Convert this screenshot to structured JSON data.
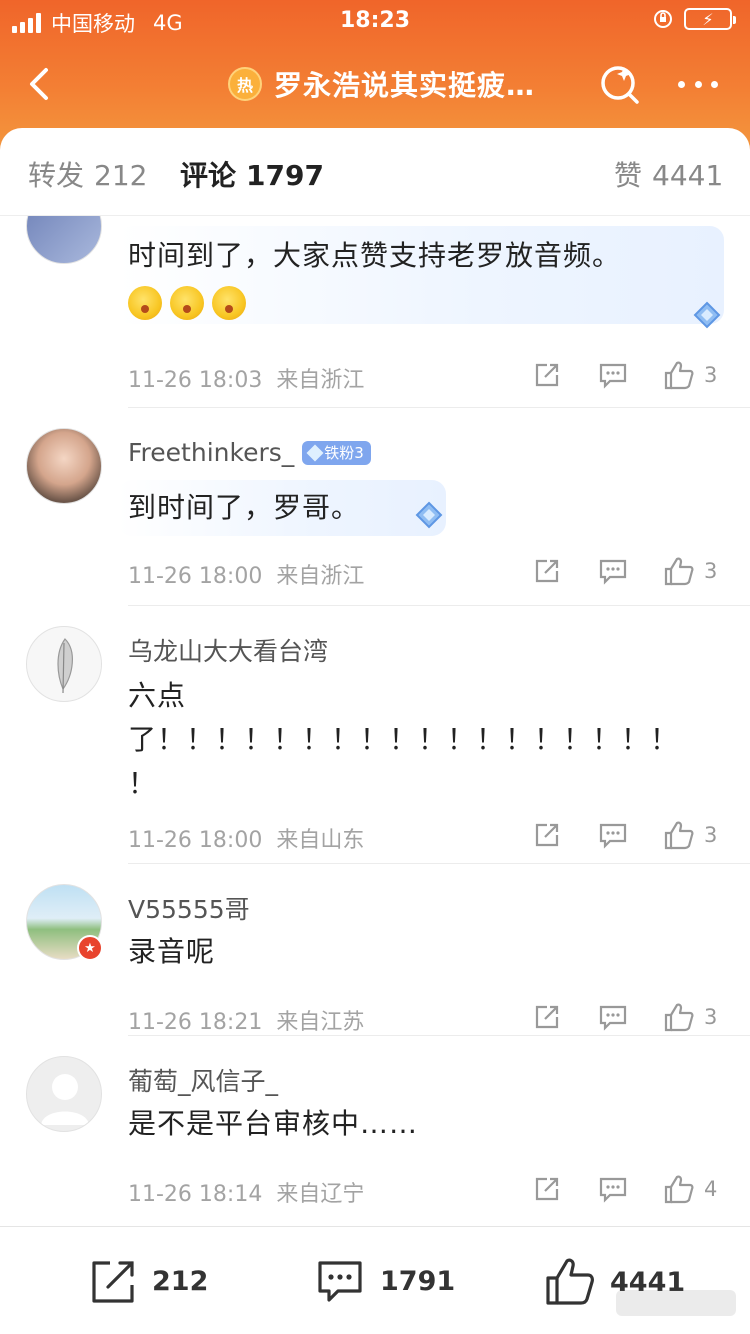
{
  "status_bar": {
    "carrier": "中国移动",
    "network": "4G",
    "time": "18:23",
    "battery_icon": "battery-charging-icon"
  },
  "header": {
    "hot_badge": "热",
    "title": "罗永浩说其实挺疲…",
    "colors": {
      "gradient_top": "#f0652a",
      "gradient_bottom": "#f39a3f"
    }
  },
  "tabs": [
    {
      "label": "转发",
      "count": "212"
    },
    {
      "label": "评论",
      "count": "1797"
    },
    {
      "label": "赞",
      "count": "4441"
    }
  ],
  "comments": [
    {
      "username": "",
      "text": "时间到了，大家点赞支持老罗放音频。",
      "emoji_count": 3,
      "time": "11-26 18:03",
      "region": "来自浙江",
      "likes": "3"
    },
    {
      "username": "Freethinkers_",
      "badge": "铁粉3",
      "text": "到时间了，罗哥。",
      "time": "11-26 18:00",
      "region": "来自浙江",
      "likes": "3"
    },
    {
      "username": "乌龙山大大看台湾",
      "text_lines": [
        "六点",
        "了！！！！！！！！！！！！！！！！！！",
        "！"
      ],
      "time": "11-26 18:00",
      "region": "来自山东",
      "likes": "3"
    },
    {
      "username": "V55555哥",
      "text": "录音呢",
      "time": "11-26 18:21",
      "region": "来自江苏",
      "likes": "3"
    },
    {
      "username": "葡萄_风信子_",
      "text": "是不是平台审核中……",
      "time": "11-26 18:14",
      "region": "来自辽宁",
      "likes": "4"
    }
  ],
  "bottom_bar": {
    "repost_count": "212",
    "comment_count": "1791",
    "like_count": "4441"
  }
}
